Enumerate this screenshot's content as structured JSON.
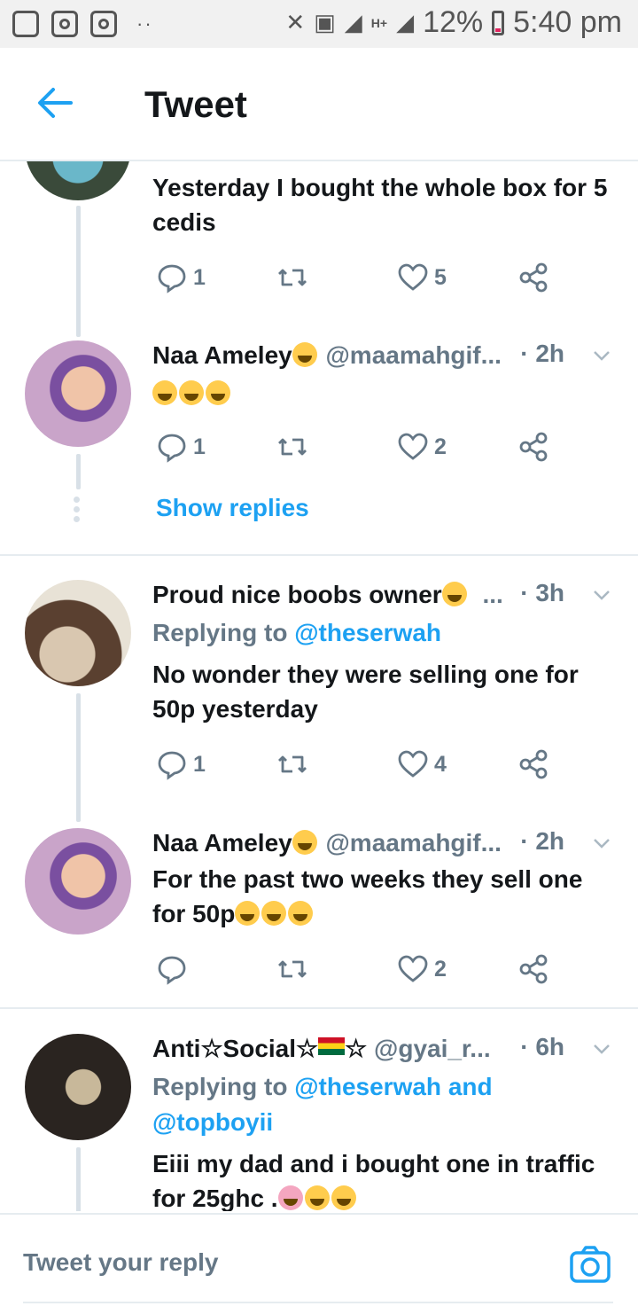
{
  "status_bar": {
    "battery": "12%",
    "time": "5:40 pm",
    "dots": "··",
    "network": "H+"
  },
  "header": {
    "title": "Tweet",
    "back_icon": "arrow-left-icon"
  },
  "tweets": [
    {
      "text": "Yesterday I bought the whole box for 5 cedis",
      "replies": "1",
      "likes": "5"
    },
    {
      "name": "Naa Ameley",
      "handle": "@maamahgif...",
      "time": "· 2h",
      "replies": "1",
      "likes": "2",
      "show_replies": "Show replies"
    },
    {
      "name": "Proud nice boobs owner",
      "ellipsis": "...",
      "time": "· 3h",
      "replying_prefix": "Replying to ",
      "replying_to": "@theserwah",
      "text": "No wonder they were selling one for 50p yesterday",
      "replies": "1",
      "likes": "4"
    },
    {
      "name": "Naa Ameley",
      "handle": "@maamahgif...",
      "time": "· 2h",
      "text": "For the past two weeks they sell one for 50p",
      "likes": "2"
    },
    {
      "name_a": "Anti",
      "name_b": "Social",
      "star": "☆",
      "handle": "@gyai_r...",
      "time": "· 6h",
      "replying_prefix": "Replying to ",
      "replying_to": "@theserwah",
      "replying_and": " and ",
      "replying_to2": "@topboyii",
      "text": "Eiii my dad and i bought one in traffic for 25ghc ."
    }
  ],
  "reply_bar": {
    "placeholder": "Tweet your reply",
    "camera_icon": "camera-icon"
  },
  "colors": {
    "accent": "#1da1f2",
    "secondary_text": "#657786",
    "divider": "#e6ecf0"
  }
}
